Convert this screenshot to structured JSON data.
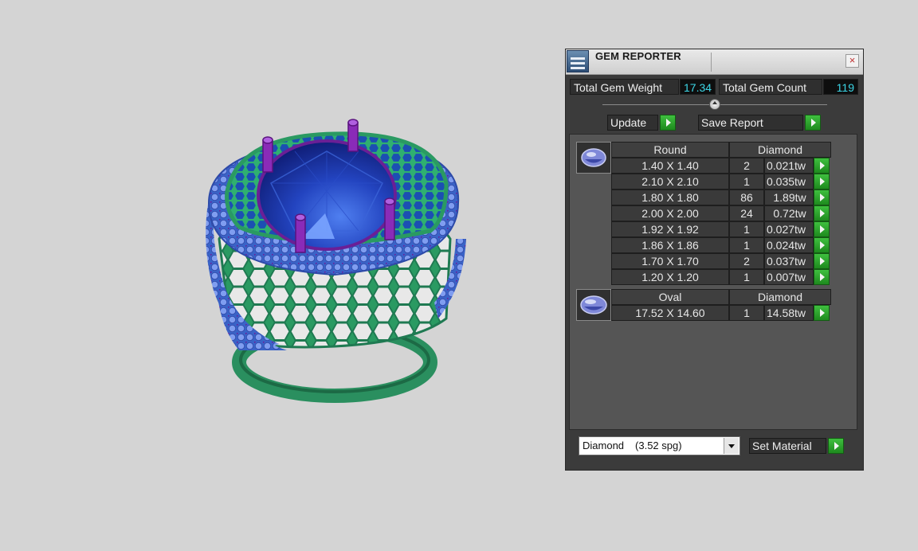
{
  "panel": {
    "title": "GEM REPORTER",
    "close_symbol": "×",
    "total_weight_label": "Total Gem Weight",
    "total_weight_value": "17.34",
    "total_count_label": "Total Gem Count",
    "total_count_value": "119",
    "update_label": "Update",
    "save_report_label": "Save Report",
    "groups": [
      {
        "shape": "Round",
        "material": "Diamond",
        "rows": [
          {
            "size": "1.40 X 1.40",
            "count": "2",
            "weight": "0.021tw"
          },
          {
            "size": "2.10 X 2.10",
            "count": "1",
            "weight": "0.035tw"
          },
          {
            "size": "1.80 X 1.80",
            "count": "86",
            "weight": "1.89tw"
          },
          {
            "size": "2.00 X 2.00",
            "count": "24",
            "weight": "0.72tw"
          },
          {
            "size": "1.92 X 1.92",
            "count": "1",
            "weight": "0.027tw"
          },
          {
            "size": "1.86 X 1.86",
            "count": "1",
            "weight": "0.024tw"
          },
          {
            "size": "1.70 X 1.70",
            "count": "2",
            "weight": "0.037tw"
          },
          {
            "size": "1.20 X 1.20",
            "count": "1",
            "weight": "0.007tw"
          }
        ]
      },
      {
        "shape": "Oval",
        "material": "Diamond",
        "rows": [
          {
            "size": "17.52 X 14.60",
            "count": "1",
            "weight": "14.58tw"
          }
        ]
      }
    ],
    "material_select": {
      "name": "Diamond",
      "spg": "(3.52 spg)"
    },
    "set_material_label": "Set Material"
  },
  "colors": {
    "ring_metal": "#2fa36b",
    "side_stones": "#5d7fd8",
    "prongs": "#7a1fa0",
    "center_stone": "#1d3fb0",
    "go_button": "#2aa02a"
  },
  "icons": [
    "app-icon",
    "close-icon",
    "slider-knob",
    "play-arrow-icon",
    "gem-round-icon",
    "gem-oval-icon",
    "dropdown-arrow-icon"
  ]
}
